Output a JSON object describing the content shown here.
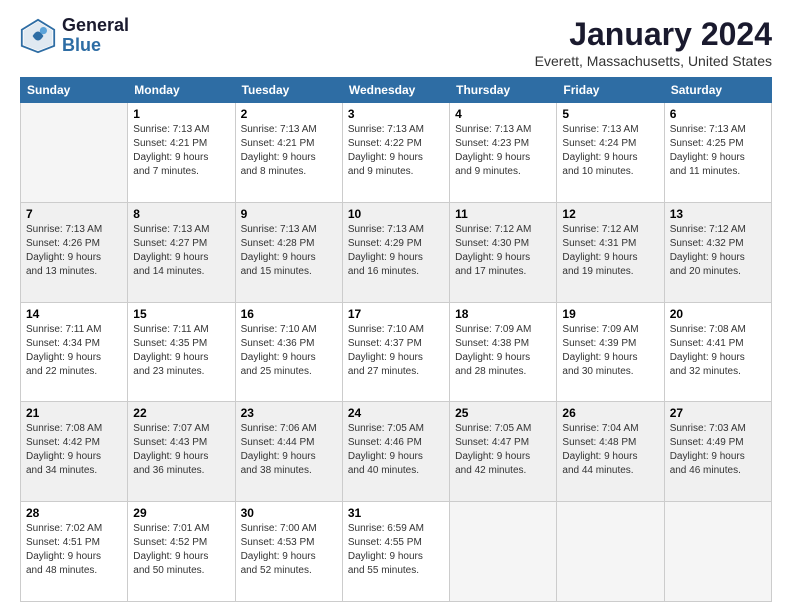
{
  "logo": {
    "line1": "General",
    "line2": "Blue"
  },
  "title": "January 2024",
  "subtitle": "Everett, Massachusetts, United States",
  "days_header": [
    "Sunday",
    "Monday",
    "Tuesday",
    "Wednesday",
    "Thursday",
    "Friday",
    "Saturday"
  ],
  "weeks": [
    [
      {
        "day": "",
        "info": ""
      },
      {
        "day": "1",
        "info": "Sunrise: 7:13 AM\nSunset: 4:21 PM\nDaylight: 9 hours\nand 7 minutes."
      },
      {
        "day": "2",
        "info": "Sunrise: 7:13 AM\nSunset: 4:21 PM\nDaylight: 9 hours\nand 8 minutes."
      },
      {
        "day": "3",
        "info": "Sunrise: 7:13 AM\nSunset: 4:22 PM\nDaylight: 9 hours\nand 9 minutes."
      },
      {
        "day": "4",
        "info": "Sunrise: 7:13 AM\nSunset: 4:23 PM\nDaylight: 9 hours\nand 9 minutes."
      },
      {
        "day": "5",
        "info": "Sunrise: 7:13 AM\nSunset: 4:24 PM\nDaylight: 9 hours\nand 10 minutes."
      },
      {
        "day": "6",
        "info": "Sunrise: 7:13 AM\nSunset: 4:25 PM\nDaylight: 9 hours\nand 11 minutes."
      }
    ],
    [
      {
        "day": "7",
        "info": "Sunrise: 7:13 AM\nSunset: 4:26 PM\nDaylight: 9 hours\nand 13 minutes."
      },
      {
        "day": "8",
        "info": "Sunrise: 7:13 AM\nSunset: 4:27 PM\nDaylight: 9 hours\nand 14 minutes."
      },
      {
        "day": "9",
        "info": "Sunrise: 7:13 AM\nSunset: 4:28 PM\nDaylight: 9 hours\nand 15 minutes."
      },
      {
        "day": "10",
        "info": "Sunrise: 7:13 AM\nSunset: 4:29 PM\nDaylight: 9 hours\nand 16 minutes."
      },
      {
        "day": "11",
        "info": "Sunrise: 7:12 AM\nSunset: 4:30 PM\nDaylight: 9 hours\nand 17 minutes."
      },
      {
        "day": "12",
        "info": "Sunrise: 7:12 AM\nSunset: 4:31 PM\nDaylight: 9 hours\nand 19 minutes."
      },
      {
        "day": "13",
        "info": "Sunrise: 7:12 AM\nSunset: 4:32 PM\nDaylight: 9 hours\nand 20 minutes."
      }
    ],
    [
      {
        "day": "14",
        "info": "Sunrise: 7:11 AM\nSunset: 4:34 PM\nDaylight: 9 hours\nand 22 minutes."
      },
      {
        "day": "15",
        "info": "Sunrise: 7:11 AM\nSunset: 4:35 PM\nDaylight: 9 hours\nand 23 minutes."
      },
      {
        "day": "16",
        "info": "Sunrise: 7:10 AM\nSunset: 4:36 PM\nDaylight: 9 hours\nand 25 minutes."
      },
      {
        "day": "17",
        "info": "Sunrise: 7:10 AM\nSunset: 4:37 PM\nDaylight: 9 hours\nand 27 minutes."
      },
      {
        "day": "18",
        "info": "Sunrise: 7:09 AM\nSunset: 4:38 PM\nDaylight: 9 hours\nand 28 minutes."
      },
      {
        "day": "19",
        "info": "Sunrise: 7:09 AM\nSunset: 4:39 PM\nDaylight: 9 hours\nand 30 minutes."
      },
      {
        "day": "20",
        "info": "Sunrise: 7:08 AM\nSunset: 4:41 PM\nDaylight: 9 hours\nand 32 minutes."
      }
    ],
    [
      {
        "day": "21",
        "info": "Sunrise: 7:08 AM\nSunset: 4:42 PM\nDaylight: 9 hours\nand 34 minutes."
      },
      {
        "day": "22",
        "info": "Sunrise: 7:07 AM\nSunset: 4:43 PM\nDaylight: 9 hours\nand 36 minutes."
      },
      {
        "day": "23",
        "info": "Sunrise: 7:06 AM\nSunset: 4:44 PM\nDaylight: 9 hours\nand 38 minutes."
      },
      {
        "day": "24",
        "info": "Sunrise: 7:05 AM\nSunset: 4:46 PM\nDaylight: 9 hours\nand 40 minutes."
      },
      {
        "day": "25",
        "info": "Sunrise: 7:05 AM\nSunset: 4:47 PM\nDaylight: 9 hours\nand 42 minutes."
      },
      {
        "day": "26",
        "info": "Sunrise: 7:04 AM\nSunset: 4:48 PM\nDaylight: 9 hours\nand 44 minutes."
      },
      {
        "day": "27",
        "info": "Sunrise: 7:03 AM\nSunset: 4:49 PM\nDaylight: 9 hours\nand 46 minutes."
      }
    ],
    [
      {
        "day": "28",
        "info": "Sunrise: 7:02 AM\nSunset: 4:51 PM\nDaylight: 9 hours\nand 48 minutes."
      },
      {
        "day": "29",
        "info": "Sunrise: 7:01 AM\nSunset: 4:52 PM\nDaylight: 9 hours\nand 50 minutes."
      },
      {
        "day": "30",
        "info": "Sunrise: 7:00 AM\nSunset: 4:53 PM\nDaylight: 9 hours\nand 52 minutes."
      },
      {
        "day": "31",
        "info": "Sunrise: 6:59 AM\nSunset: 4:55 PM\nDaylight: 9 hours\nand 55 minutes."
      },
      {
        "day": "",
        "info": ""
      },
      {
        "day": "",
        "info": ""
      },
      {
        "day": "",
        "info": ""
      }
    ]
  ]
}
